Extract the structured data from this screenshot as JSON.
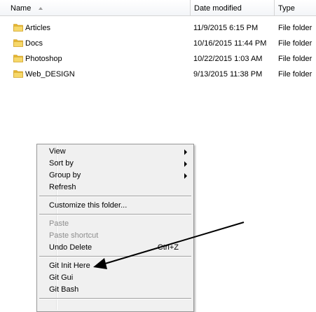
{
  "columns": {
    "name": "Name",
    "date_modified": "Date modified",
    "type": "Type"
  },
  "sort": {
    "column": "name",
    "direction": "ascending"
  },
  "files": [
    {
      "name": "Articles",
      "date_modified": "11/9/2015 6:15 PM",
      "type": "File folder",
      "icon": "folder-icon"
    },
    {
      "name": "Docs",
      "date_modified": "10/16/2015 11:44 PM",
      "type": "File folder",
      "icon": "folder-icon"
    },
    {
      "name": "Photoshop",
      "date_modified": "10/22/2015 1:03 AM",
      "type": "File folder",
      "icon": "folder-icon"
    },
    {
      "name": "Web_DESIGN",
      "date_modified": "9/13/2015 11:38 PM",
      "type": "File folder",
      "icon": "folder-icon"
    }
  ],
  "context_menu": {
    "view": "View",
    "sort_by": "Sort by",
    "group_by": "Group by",
    "refresh": "Refresh",
    "customize": "Customize this folder...",
    "paste": "Paste",
    "paste_shortcut": "Paste shortcut",
    "undo_delete": "Undo Delete",
    "undo_delete_shortcut": "Ctrl+Z",
    "git_init": "Git Init Here",
    "git_gui": "Git Gui",
    "git_bash": "Git Bash"
  },
  "colors": {
    "folder_body": "#e8b830",
    "folder_front": "#f6d86a",
    "menu_background": "#f0f0f0",
    "disabled_text": "#8d8d8d",
    "annotation_arrow": "#000000"
  }
}
